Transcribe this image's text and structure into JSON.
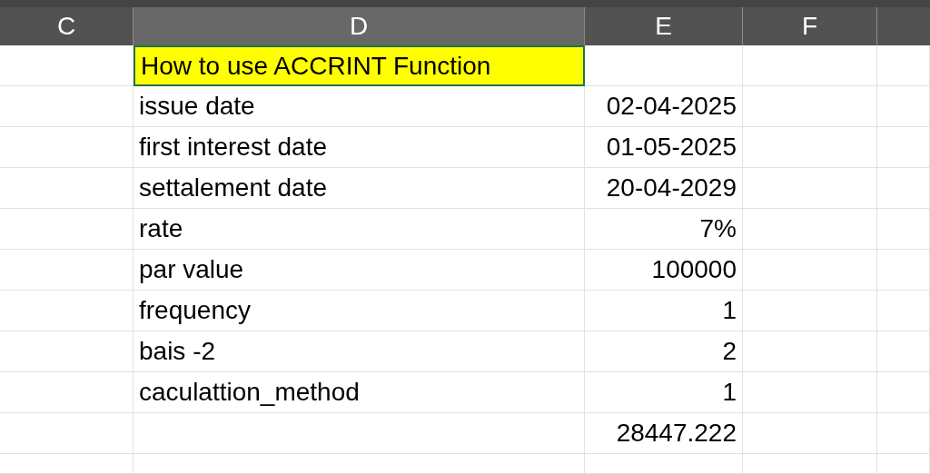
{
  "columns": [
    {
      "label": "C",
      "selected": false
    },
    {
      "label": "D",
      "selected": true
    },
    {
      "label": "E",
      "selected": false
    },
    {
      "label": "F",
      "selected": false
    }
  ],
  "rows": [
    {
      "label": "How to use ACCRINT Function",
      "highlighted": true,
      "selected": true
    },
    {
      "label": "issue date",
      "value": "02-04-2025",
      "highlighted": false,
      "selected": false
    },
    {
      "label": "first interest date",
      "value": "01-05-2025",
      "highlighted": false,
      "selected": false
    },
    {
      "label": "settalement date",
      "value": "20-04-2029",
      "highlighted": false,
      "selected": false
    },
    {
      "label": "rate",
      "value": "7%",
      "highlighted": false,
      "selected": false
    },
    {
      "label": "par value",
      "value": "100000",
      "highlighted": false,
      "selected": false
    },
    {
      "label": "frequency",
      "value": "1",
      "highlighted": false,
      "selected": false
    },
    {
      "label": "bais -2",
      "value": "2",
      "highlighted": false,
      "selected": false
    },
    {
      "label": "caculattion_method",
      "value": "1",
      "highlighted": false,
      "selected": false
    },
    {
      "value": "28447.222",
      "highlighted": false,
      "selected": false
    }
  ]
}
